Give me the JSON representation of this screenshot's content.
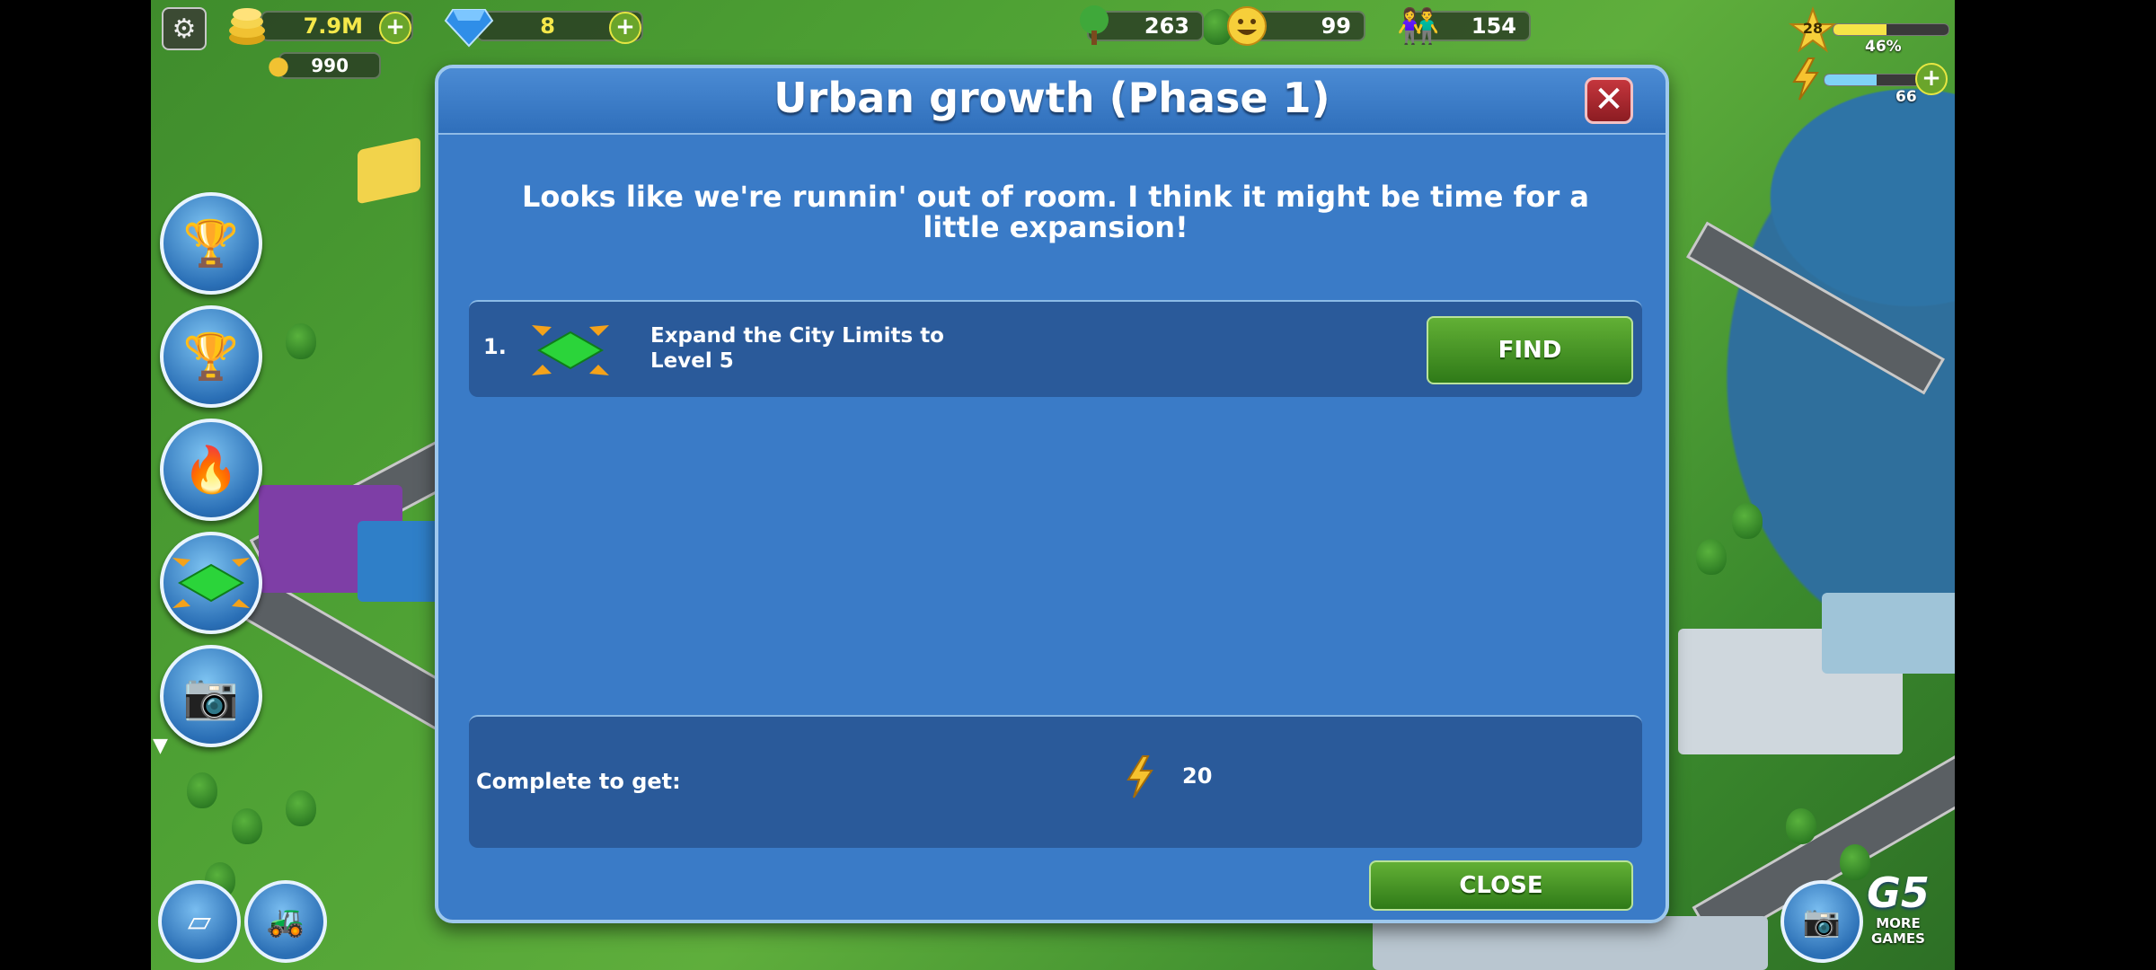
{
  "hud": {
    "coins": "7.9M",
    "gems": "8",
    "greenbacks": "990",
    "trees": "263",
    "happiness": "99",
    "population": "154",
    "level": "28",
    "xp_percent_label": "46%",
    "xp_percent": 46,
    "energy": "66",
    "energy_fraction": 0.45
  },
  "dialog": {
    "title": "Urban growth (Phase 1)",
    "message": "Looks like we're runnin' out of room. I think it might be time for a little expansion!",
    "task": {
      "number": "1.",
      "text": "Expand the City Limits to Level 5",
      "find_label": "FIND"
    },
    "reward": {
      "label": "Complete to get:",
      "value": "20"
    },
    "close_label": "CLOSE"
  },
  "branding": {
    "publisher": "G5",
    "more_games_label": "MORE GAMES"
  },
  "colors": {
    "dialog_bg": "#3a7bc7",
    "panel_bg": "#2a5a9a",
    "button_green": "#4a9a26",
    "close_red": "#b02a31"
  }
}
